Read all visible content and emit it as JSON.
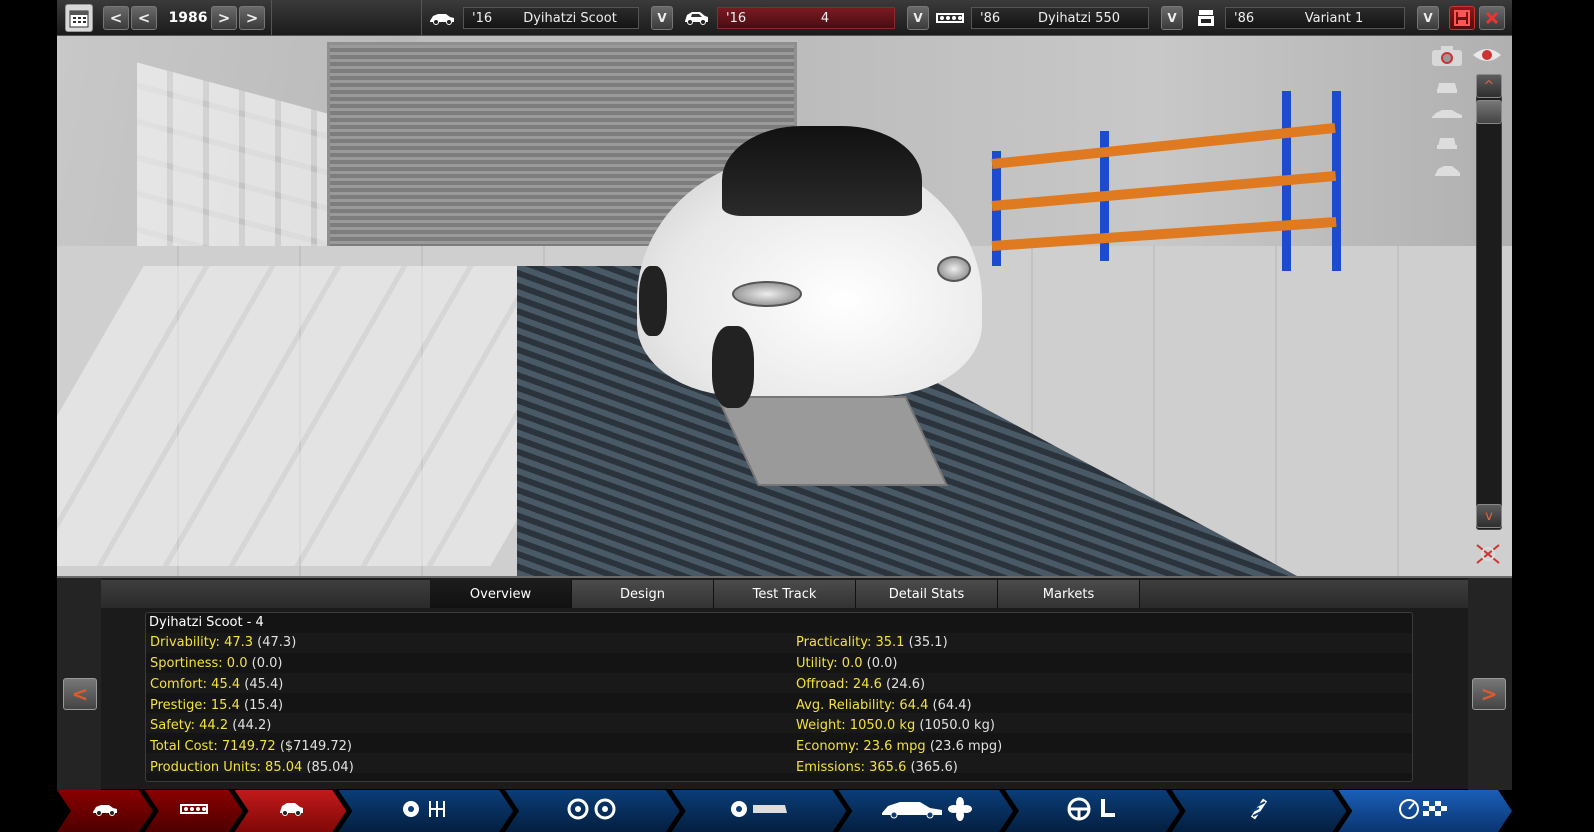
{
  "topbar": {
    "year": "1986",
    "prev_label": "<",
    "prev_fast_label": "<",
    "next_label": ">",
    "next_fast_label": ">",
    "model": {
      "year": "'16",
      "name": "Dyihatzi Scoot"
    },
    "trim": {
      "year": "'16",
      "name": "4"
    },
    "engine": {
      "year": "'86",
      "name": "Dyihatzi 550"
    },
    "variant": {
      "year": "'86",
      "name": "Variant 1"
    },
    "dropdown_label": "V"
  },
  "viewport": {
    "scroll_up_label": "^",
    "scroll_down_label": "v"
  },
  "panel": {
    "tabs": [
      {
        "label": "Overview",
        "active": true
      },
      {
        "label": "Design",
        "active": false
      },
      {
        "label": "Test Track",
        "active": false
      },
      {
        "label": "Detail Stats",
        "active": false
      },
      {
        "label": "Markets",
        "active": false
      }
    ],
    "title": "Dyihatzi Scoot - 4",
    "left_stats": [
      {
        "label": "Drivability: 47.3",
        "value": "(47.3)"
      },
      {
        "label": "Sportiness: 0.0",
        "value": "(0.0)"
      },
      {
        "label": "Comfort: 45.4",
        "value": "(45.4)"
      },
      {
        "label": "Prestige: 15.4",
        "value": "(15.4)"
      },
      {
        "label": "Safety: 44.2",
        "value": "(44.2)"
      },
      {
        "label": "Total Cost: 7149.72",
        "value": "($7149.72)"
      },
      {
        "label": "Production Units: 85.04",
        "value": "(85.04)"
      }
    ],
    "right_stats": [
      {
        "label": "Practicality: 35.1",
        "value": "(35.1)"
      },
      {
        "label": "Utility: 0.0",
        "value": "(0.0)"
      },
      {
        "label": "Offroad: 24.6",
        "value": "(24.6)"
      },
      {
        "label": "Avg. Reliability: 64.4",
        "value": "(64.4)"
      },
      {
        "label": "Weight: 1050.0 kg",
        "value": "(1050.0 kg)"
      },
      {
        "label": "Economy: 23.6 mpg",
        "value": "(23.6 mpg)"
      },
      {
        "label": "Emissions: 365.6",
        "value": "(365.6)"
      }
    ],
    "prev_arrow": "<",
    "next_arrow": ">"
  },
  "bottom_nav": [
    {
      "icon": "car-model-icon",
      "active": false
    },
    {
      "icon": "engine-block-icon",
      "active": false
    },
    {
      "icon": "car-trim-icon",
      "active": true
    },
    {
      "icon": "gearbox-icon",
      "active": false
    },
    {
      "icon": "wheels-icon",
      "active": false
    },
    {
      "icon": "fixture-icon",
      "active": false
    },
    {
      "icon": "body-cooling-icon",
      "active": false
    },
    {
      "icon": "interior-icon",
      "active": false
    },
    {
      "icon": "suspension-icon",
      "active": false
    },
    {
      "icon": "testing-icon",
      "active": false
    }
  ],
  "colors": {
    "stat_label": "#f2e23a",
    "stat_value": "#e0e0e0",
    "accent_red": "#c21a1a",
    "accent_blue": "#1a5fb8"
  }
}
